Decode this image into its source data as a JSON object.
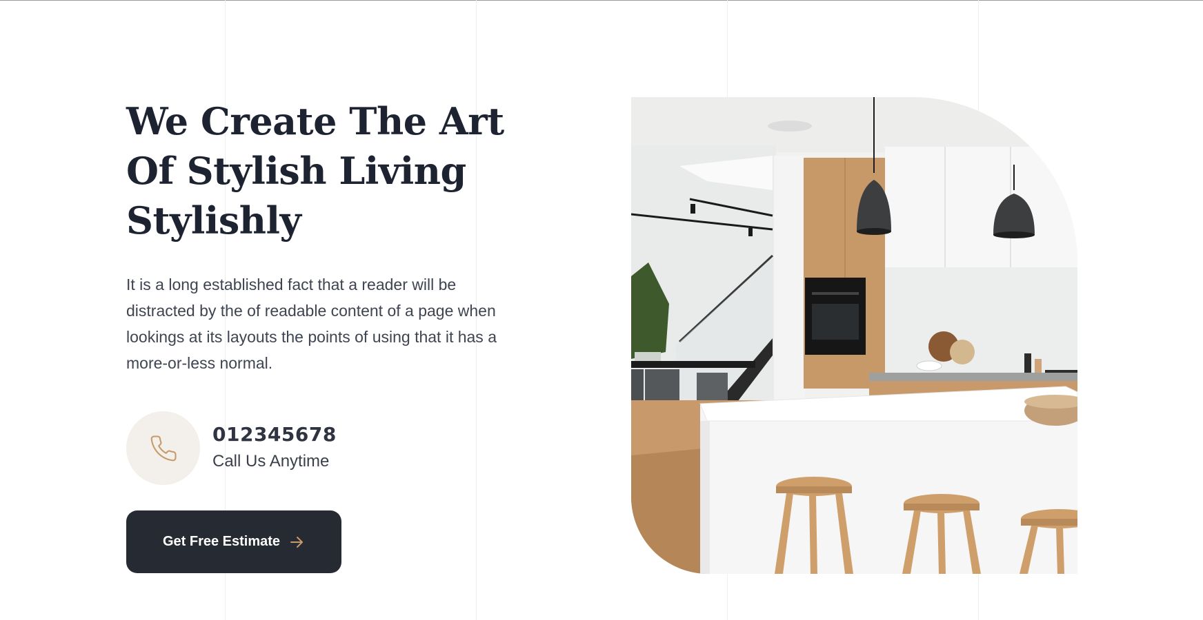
{
  "hero": {
    "title_lines": [
      "We Create The Art",
      "Of Stylish Living",
      "Stylishly"
    ],
    "description": "It is a long established fact that a reader will be distracted by the of readable content of a page when lookings at its layouts the points of using that it has a more-or-less normal."
  },
  "contact": {
    "phone": "012345678",
    "caption": "Call Us Anytime",
    "icon": "phone-icon"
  },
  "cta": {
    "label": "Get Free Estimate",
    "icon": "arrow-right-icon"
  },
  "image": {
    "subject": "kitchen-interior"
  },
  "colors": {
    "heading": "#1e2332",
    "text": "#3f4451",
    "accent": "#c69a6a",
    "button_bg": "#262b33",
    "badge_bg": "#f3efea"
  }
}
